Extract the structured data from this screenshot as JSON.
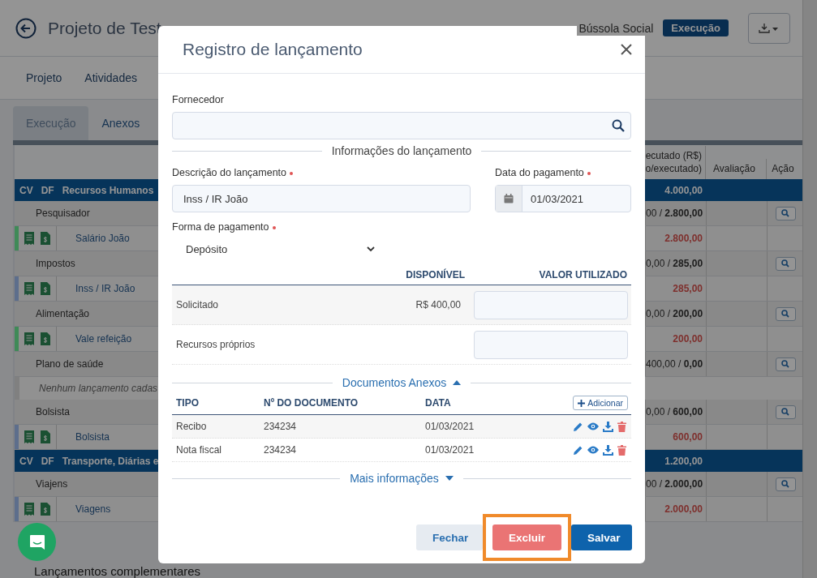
{
  "header": {
    "title": "Projeto de Test",
    "organization": "Bússola Social",
    "status_badge": "Execução"
  },
  "nav": [
    {
      "label": "Projeto"
    },
    {
      "label": "Atividades"
    }
  ],
  "tabs": [
    {
      "label": "Execução",
      "selected": true
    },
    {
      "label": "Anexos",
      "selected": false
    }
  ],
  "table": {
    "columns": {
      "executed": [
        "ecutado (R$)",
        "o/executado)"
      ],
      "evaluation": "Avaliação",
      "action": "Ação"
    },
    "rows": [
      {
        "kind": "group",
        "cv": "CV",
        "df": "DF",
        "name": "Recursos Humanos",
        "executed": "4.000,00"
      },
      {
        "kind": "category",
        "name": "Pesquisador",
        "executed": "00 / **2.800,00**"
      },
      {
        "kind": "item",
        "name": "Salário João",
        "executed": "2.800,00",
        "color": "#3f8a57"
      },
      {
        "kind": "category",
        "name": "Impostos",
        "executed": "0,00 / **285,00**"
      },
      {
        "kind": "item",
        "name": "Inss / IR João",
        "executed": "285,00",
        "color": "#5d6e8c"
      },
      {
        "kind": "category",
        "name": "Alimentação",
        "executed": "0,00 / **200,00**"
      },
      {
        "kind": "item",
        "name": "Vale refeição",
        "executed": "200,00",
        "color": "#3f8a57"
      },
      {
        "kind": "category",
        "name": "Plano de saúde",
        "executed": "400,00 / **0,00**"
      },
      {
        "kind": "empty",
        "name": "Nenhum lançamento cadas"
      },
      {
        "kind": "category",
        "name": "Bolsista",
        "executed": "0,00 / **600,00**"
      },
      {
        "kind": "item",
        "name": "Bolsista",
        "executed": "600,00",
        "color": "#5d6e8c"
      },
      {
        "kind": "group",
        "cv": "CV",
        "df": "DF",
        "name": "Transporte, Diárias e",
        "executed": "1.200,00"
      },
      {
        "kind": "category",
        "name": "Viajens",
        "executed": "00 / **2.000,00**"
      },
      {
        "kind": "item",
        "name": "Viagens",
        "executed": "2.000,00",
        "color": "#5d6e8c"
      }
    ]
  },
  "section_below": "Lançamentos complementares",
  "modal": {
    "title": "Registro de lançamento",
    "supplier": {
      "label": "Fornecedor"
    },
    "section_title": "Informações do lançamento",
    "description": {
      "label": "Descrição do lançamento",
      "required": true,
      "value": "Inss / IR João"
    },
    "payment_date": {
      "label": "Data do pagamento",
      "required": true,
      "value": "01/03/2021"
    },
    "payment_method": {
      "label": "Forma de pagamento",
      "required": true,
      "value": "Depósito"
    },
    "funds": {
      "columns": [
        "DISPONÍVEL",
        "VALOR UTILIZADO"
      ],
      "rows": [
        {
          "label": "Solicitado",
          "available": "R$ 400,00"
        },
        {
          "label": "Recursos próprios"
        }
      ]
    },
    "documents": {
      "title": "Documentos Anexos",
      "expanded": true,
      "add_button": "Adicionar",
      "columns": [
        "TIPO",
        "Nº DO DOCUMENTO",
        "DATA"
      ],
      "rows": [
        {
          "type": "Recibo",
          "number": "234234",
          "date": "01/03/2021"
        },
        {
          "type": "Nota fiscal",
          "number": "234234",
          "date": "01/03/2021"
        }
      ]
    },
    "more_info": {
      "title": "Mais informações",
      "expanded": false
    },
    "buttons": [
      {
        "label": "Fechar",
        "kind": "secondary",
        "highlighted": false
      },
      {
        "label": "Excluir",
        "kind": "danger",
        "highlighted": true
      },
      {
        "label": "Salvar",
        "kind": "primary",
        "highlighted": false
      }
    ]
  }
}
